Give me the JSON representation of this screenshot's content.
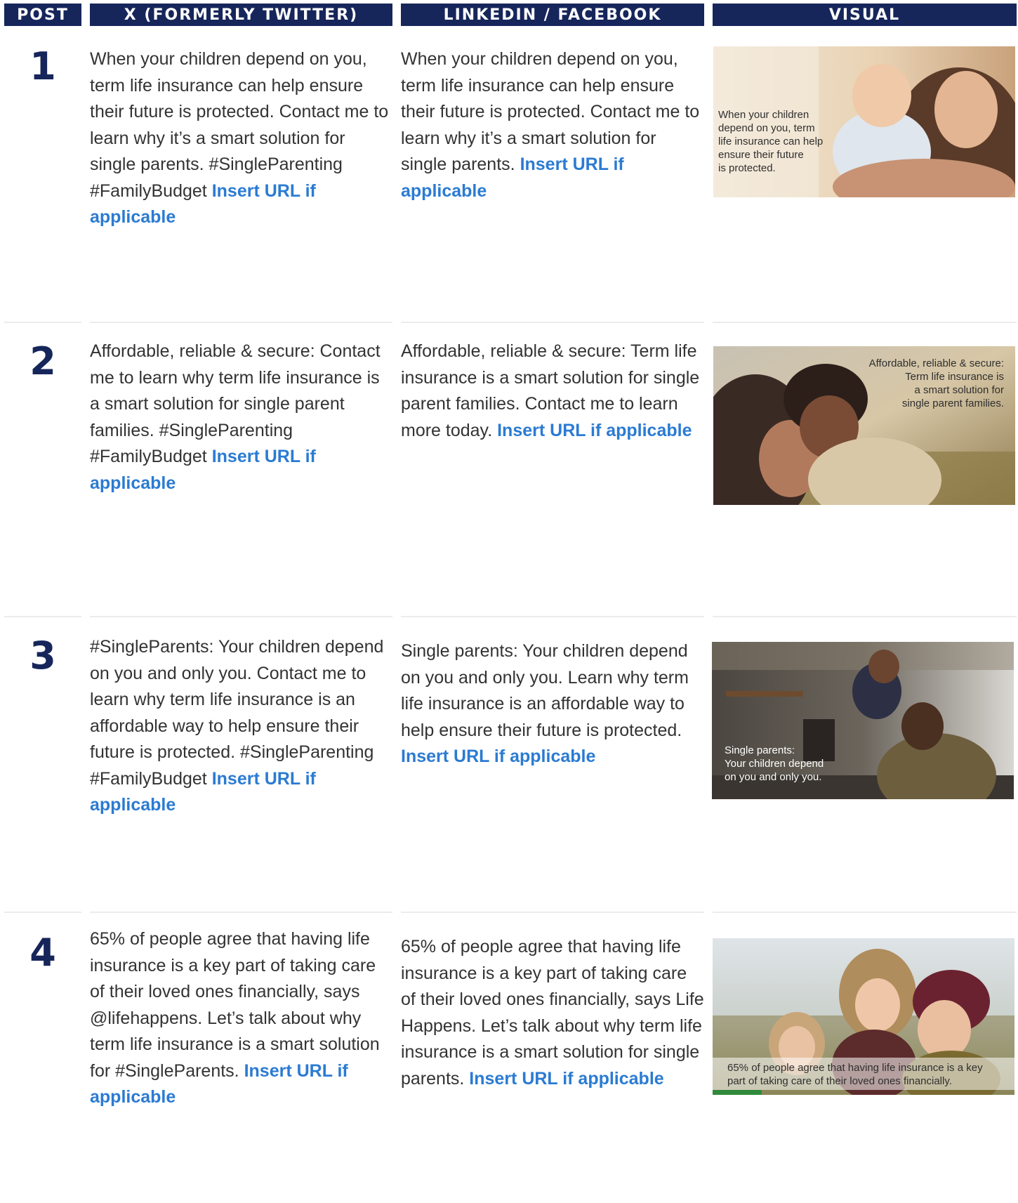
{
  "header": {
    "post": "POST",
    "x": "X (FORMERLY TWITTER)",
    "linkedin": "LINKEDIN / FACEBOOK",
    "visual": "VISUAL"
  },
  "posts": [
    {
      "number": "1",
      "x_text": "When your children depend on you, term life insurance can help ensure their future is protected. Contact me to learn why it’s a smart solution for single parents. #SingleParenting #FamilyBudget",
      "x_link": "Insert URL if applicable",
      "li_text": "When your children depend on you, term life insurance can help ensure their future is protected. Contact me to learn why it’s a smart solution for single parents.",
      "li_link": "Insert URL if applicable",
      "visual_text": [
        "When your children",
        "depend on you, term",
        "life insurance can help",
        "ensure their future",
        "is protected."
      ]
    },
    {
      "number": "2",
      "x_text": "Affordable, reliable & secure: Contact me to learn why term life insurance is a smart solution for single parent families. #SingleParenting #FamilyBudget",
      "x_link": "Insert URL if applicable",
      "li_text": "Affordable, reliable & secure: Term life insurance is a smart solution for single parent families. Contact me to learn more today.",
      "li_link": "Insert URL if applicable",
      "visual_text": [
        "Affordable, reliable & secure:",
        "Term life insurance is",
        "a smart solution for",
        "single parent families."
      ]
    },
    {
      "number": "3",
      "x_text": "#SingleParents: Your children depend on you and only you. Contact me to learn why term life insurance is an affordable way to help ensure their future is protected. #SingleParenting #FamilyBudget",
      "x_link": "Insert URL if applicable",
      "li_text": "Single parents: Your children depend on you and only you. Learn why term life insurance is an affordable way to help ensure their future is protected.",
      "li_link": "Insert URL if applicable",
      "visual_text": [
        "Single parents:",
        "Your children depend",
        "on you and only you."
      ]
    },
    {
      "number": "4",
      "x_text": "65% of people agree that having life insurance is a key part of taking care of their loved ones financially, says @lifehappens. Let’s talk about why term life insurance is a smart solution for #SingleParents.",
      "x_link": "Insert URL if applicable",
      "li_text": "65% of people agree that having life insurance is a key part of taking care of their loved ones financially, says Life Happens. Let’s talk about why term life insurance is a smart solution for single parents.",
      "li_link": "Insert URL if applicable",
      "visual_text": [
        "65% of people agree that having life insurance is a key",
        "part of taking care of their loved ones financially."
      ]
    }
  ],
  "colors": {
    "header_bg": "#16265b",
    "number": "#16265b",
    "link": "#2b7bd2",
    "body_text": "#333333"
  }
}
